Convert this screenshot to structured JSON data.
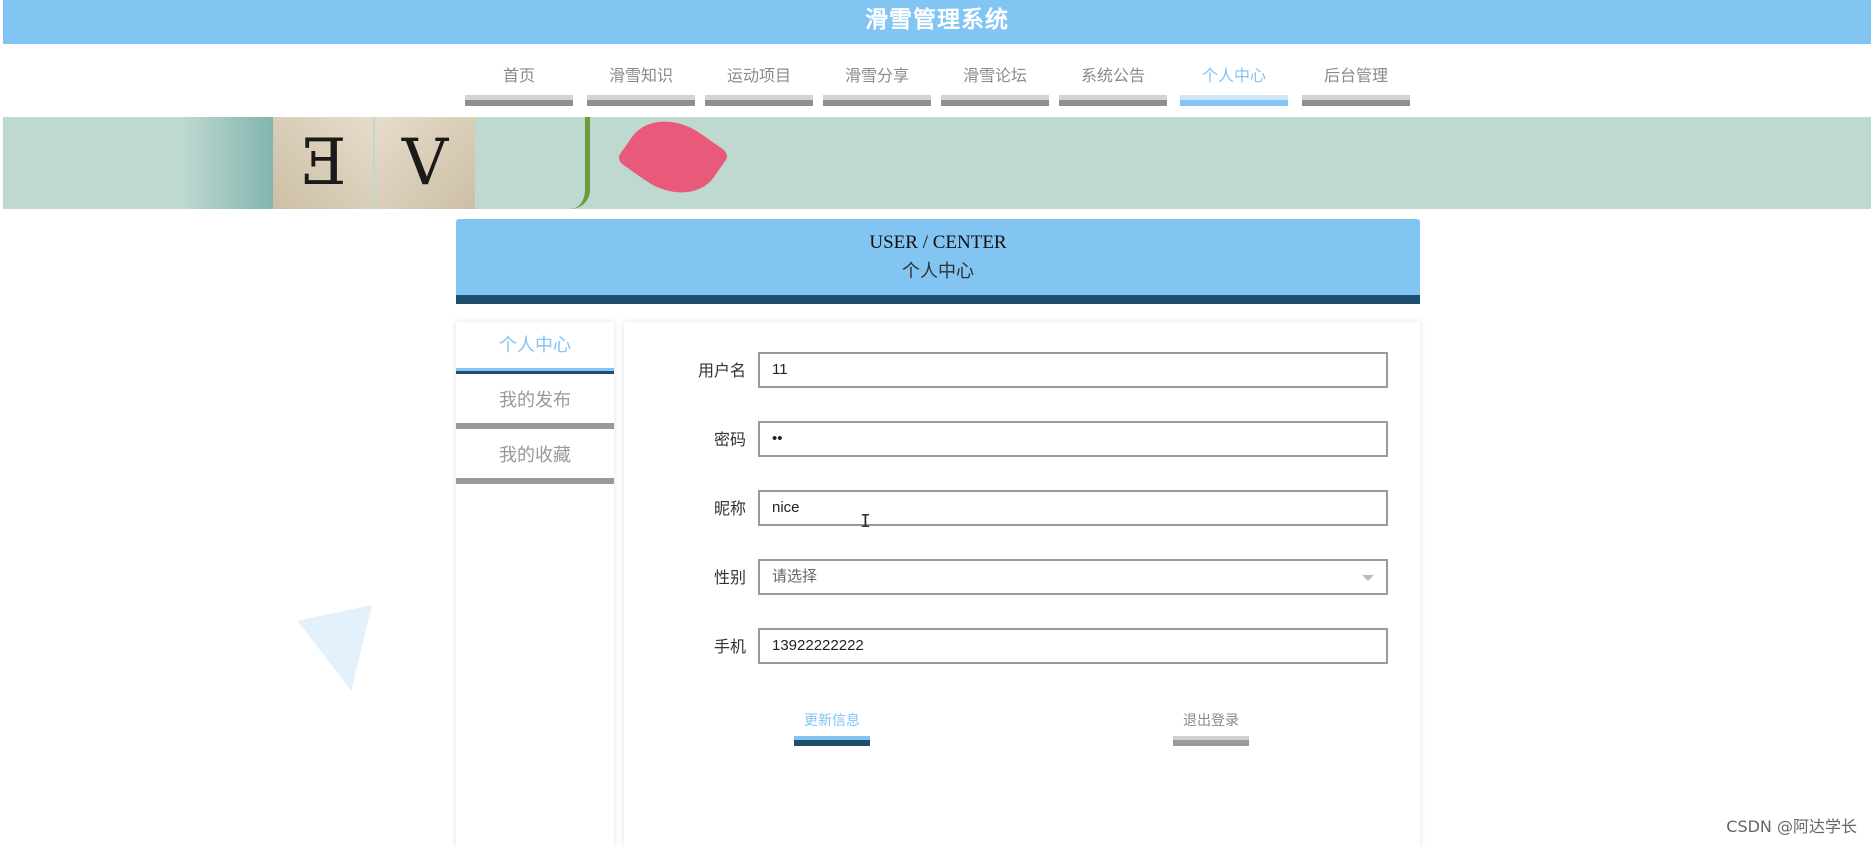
{
  "app": {
    "title": "滑雪管理系统"
  },
  "nav": [
    {
      "label": "首页",
      "active": false
    },
    {
      "label": "滑雪知识",
      "active": false
    },
    {
      "label": "运动项目",
      "active": false
    },
    {
      "label": "滑雪分享",
      "active": false
    },
    {
      "label": "滑雪论坛",
      "active": false
    },
    {
      "label": "系统公告",
      "active": false
    },
    {
      "label": "个人中心",
      "active": true
    },
    {
      "label": "后台管理",
      "active": false
    }
  ],
  "banner": {
    "tiles": [
      "E",
      "V"
    ]
  },
  "section": {
    "en": "USER / CENTER",
    "cn": "个人中心"
  },
  "sidebar": [
    {
      "label": "个人中心",
      "active": true
    },
    {
      "label": "我的发布",
      "active": false
    },
    {
      "label": "我的收藏",
      "active": false
    }
  ],
  "form": {
    "username": {
      "label": "用户名",
      "value": "11"
    },
    "password": {
      "label": "密码",
      "value": "••"
    },
    "nickname": {
      "label": "昵称",
      "value": "nice"
    },
    "gender": {
      "label": "性别",
      "placeholder": "请选择"
    },
    "phone": {
      "label": "手机",
      "value": "13922222222"
    }
  },
  "buttons": {
    "update": "更新信息",
    "logout": "退出登录"
  },
  "watermark": "CSDN @阿达学长",
  "colors": {
    "accent": "#82c4f2",
    "dark": "#1f4e6c",
    "banner": "#bdd9d0"
  }
}
